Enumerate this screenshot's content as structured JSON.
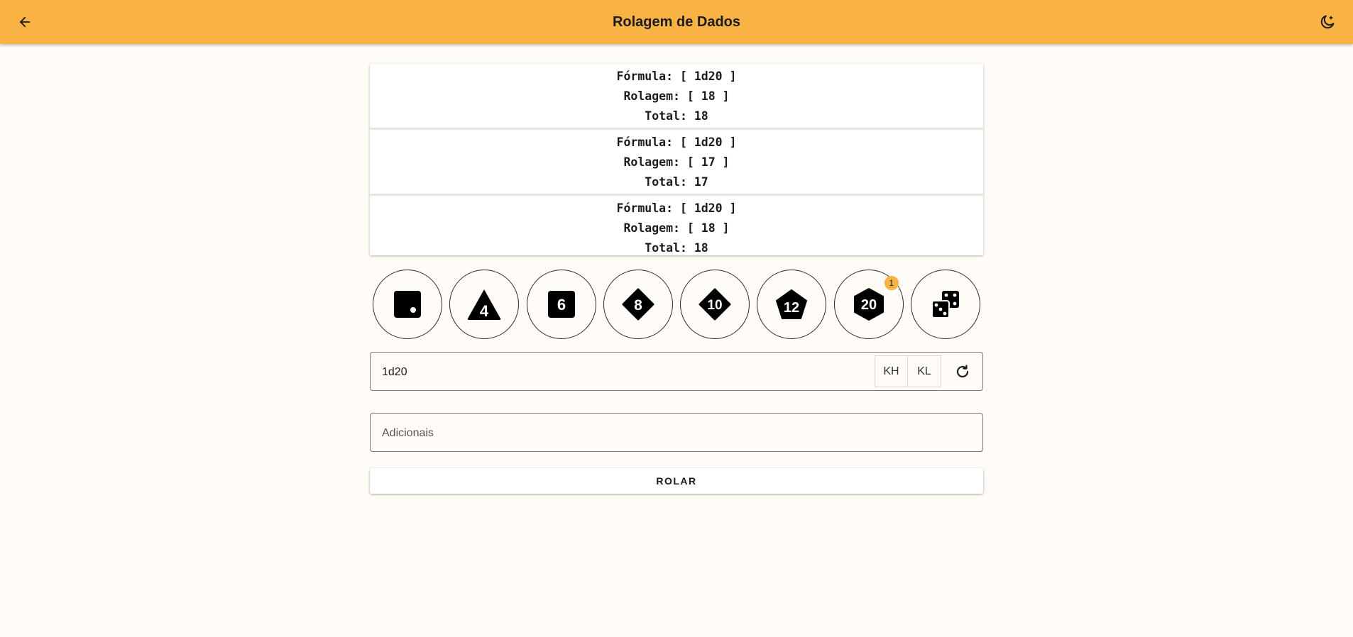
{
  "header": {
    "title": "Rolagem de Dados",
    "back_icon": "arrow-back-icon",
    "theme_icon": "dark-mode-icon",
    "accent": "#f9b342"
  },
  "results": [
    {
      "formula": "Fórmula: [ 1d20 ]",
      "roll": "Rolagem: [ 18 ]",
      "total": "Total: 18"
    },
    {
      "formula": "Fórmula: [ 1d20 ]",
      "roll": "Rolagem: [ 17 ]",
      "total": "Total: 17"
    },
    {
      "formula": "Fórmula: [ 1d20 ]",
      "roll": "Rolagem: [ 18 ]",
      "total": "Total: 18"
    }
  ],
  "dice": [
    {
      "icon": "d2-die-icon",
      "label": ""
    },
    {
      "icon": "d4-die-icon",
      "label": "4"
    },
    {
      "icon": "d6-die-icon",
      "label": "6"
    },
    {
      "icon": "d8-die-icon",
      "label": "8"
    },
    {
      "icon": "d10-die-icon",
      "label": "10"
    },
    {
      "icon": "d12-die-icon",
      "label": "12"
    },
    {
      "icon": "d20-die-icon",
      "label": "20",
      "badge": "1"
    },
    {
      "icon": "custom-dice-icon",
      "label": ""
    }
  ],
  "formula_field": {
    "value": "1d20",
    "kh_label": "KH",
    "kl_label": "KL",
    "refresh_icon": "refresh-icon"
  },
  "extras_field": {
    "placeholder": "Adicionais",
    "value": ""
  },
  "roll_button": {
    "label": "ROLAR"
  }
}
